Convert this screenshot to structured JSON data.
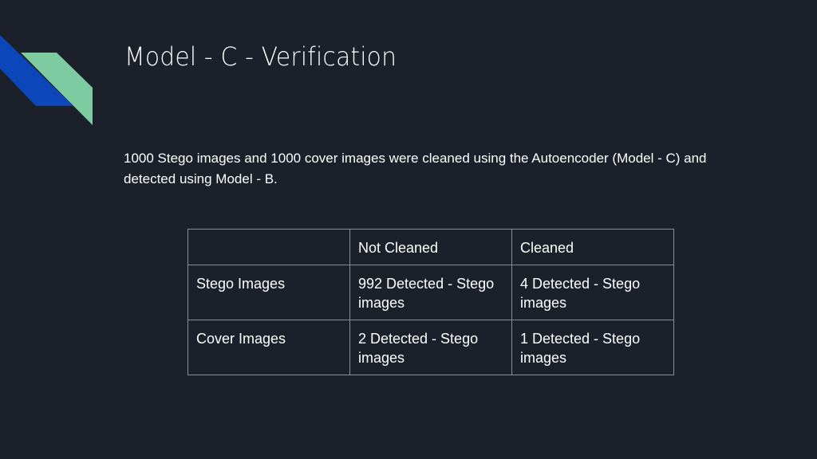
{
  "slide": {
    "title": "Model - C - Verification",
    "description": "1000 Stego images and 1000 cover images were cleaned using the Autoencoder (Model - C) and detected using Model - B.",
    "decoration": {
      "icon": "diagonal-stripes-logo",
      "colors": {
        "blue": "#0b47b8",
        "green": "#7ecba2"
      }
    },
    "colors": {
      "background": "#1c202b",
      "text": "#ffffff",
      "table_border": "#8a8d93"
    }
  },
  "table": {
    "header": [
      "",
      "Not Cleaned",
      "Cleaned"
    ],
    "rows": [
      {
        "label": "Stego Images",
        "not_cleaned": "992 Detected - Stego images",
        "cleaned": "4 Detected - Stego images"
      },
      {
        "label": "Cover Images",
        "not_cleaned": "2 Detected - Stego images",
        "cleaned": "1 Detected - Stego images"
      }
    ]
  }
}
